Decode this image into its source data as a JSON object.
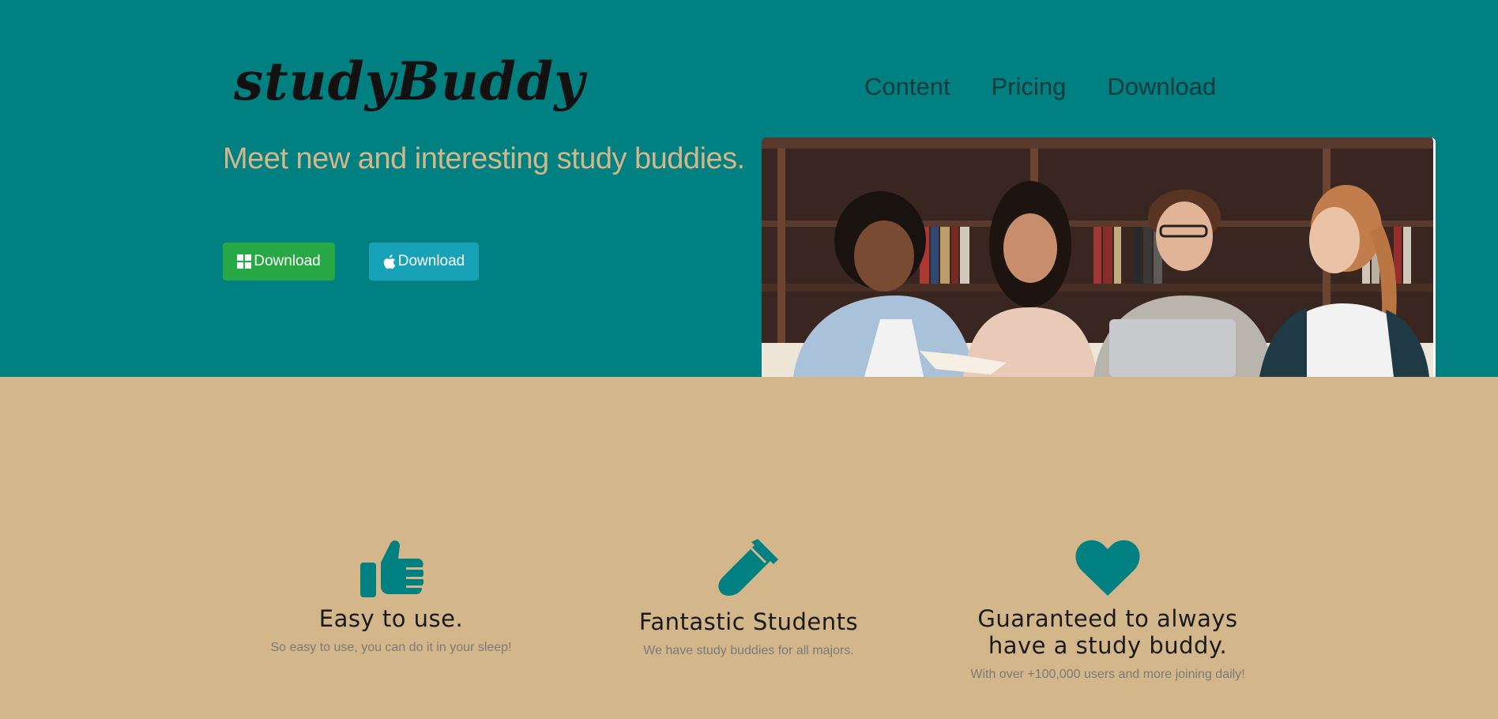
{
  "brand": {
    "logo": "studyBuddy"
  },
  "nav": {
    "items": [
      "Content",
      "Pricing",
      "Download"
    ]
  },
  "hero": {
    "tagline": "Meet new and interesting study buddies.",
    "windows_button": "Download",
    "mac_button": "Download"
  },
  "features": [
    {
      "icon": "thumbs-up-icon",
      "title": "Easy to use.",
      "text": "So easy to use, you can do it in your sleep!"
    },
    {
      "icon": "test-tube-icon",
      "title": "Fantastic Students",
      "text": "We have study buddies for all majors."
    },
    {
      "icon": "heart-icon",
      "title": "Guaranteed to always have a study buddy.",
      "text": "With over +100,000 users and more joining daily!"
    }
  ],
  "colors": {
    "hero_bg": "#008080",
    "features_bg": "#D3B68A",
    "windows_button": "#28A745",
    "mac_button": "#17A2B8"
  }
}
